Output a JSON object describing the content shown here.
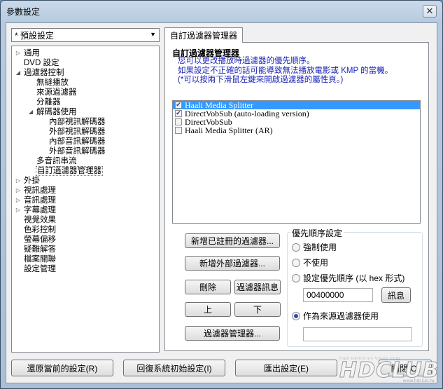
{
  "window": {
    "title": "參數設定",
    "close_glyph": "✕"
  },
  "preset": {
    "value": "* 預設設定"
  },
  "tree": [
    {
      "label": "通用",
      "level": 0,
      "expander": "▷"
    },
    {
      "label": "DVD 設定",
      "level": 0,
      "expander": ""
    },
    {
      "label": "過濾器控制",
      "level": 0,
      "expander": "◢"
    },
    {
      "label": "無縫播放",
      "level": 1,
      "expander": ""
    },
    {
      "label": "來源過濾器",
      "level": 1,
      "expander": ""
    },
    {
      "label": "分離器",
      "level": 1,
      "expander": ""
    },
    {
      "label": "解碼器使用",
      "level": 1,
      "expander": "◢"
    },
    {
      "label": "內部視訊解碼器",
      "level": 2,
      "expander": ""
    },
    {
      "label": "外部視訊解碼器",
      "level": 2,
      "expander": ""
    },
    {
      "label": "內部音訊解碼器",
      "level": 2,
      "expander": ""
    },
    {
      "label": "外部音訊解碼器",
      "level": 2,
      "expander": ""
    },
    {
      "label": "多音訊串流",
      "level": 1,
      "expander": ""
    },
    {
      "label": "自訂過濾器管理器",
      "level": 1,
      "expander": "",
      "selected": true
    },
    {
      "label": "外掛",
      "level": 0,
      "expander": "▷"
    },
    {
      "label": "視訊處理",
      "level": 0,
      "expander": "▷"
    },
    {
      "label": "音訊處理",
      "level": 0,
      "expander": "▷"
    },
    {
      "label": "字幕處理",
      "level": 0,
      "expander": "▷"
    },
    {
      "label": "視覺效果",
      "level": 0,
      "expander": ""
    },
    {
      "label": "色彩控制",
      "level": 0,
      "expander": ""
    },
    {
      "label": "螢幕偏移",
      "level": 0,
      "expander": ""
    },
    {
      "label": "疑難解答",
      "level": 0,
      "expander": ""
    },
    {
      "label": "檔案關聯",
      "level": 0,
      "expander": ""
    },
    {
      "label": "設定管理",
      "level": 0,
      "expander": ""
    }
  ],
  "tab": {
    "label": "自訂過濾器管理器"
  },
  "panel": {
    "title": "自訂過濾器管理器",
    "desc1": "您可以更改播放時過濾器的優先順序。",
    "desc2": "如果設定不正確的話可能導致無法播放電影或 KMP 的當機。",
    "desc3": "(*可以按兩下滑鼠左鍵來開啟過濾器的屬性頁。)"
  },
  "filters": [
    {
      "name": "Haali Media Splitter",
      "checked": true,
      "selected": true
    },
    {
      "name": "DirectVobSub (auto-loading version)",
      "checked": true,
      "selected": false
    },
    {
      "name": "DirectVobSub",
      "checked": false,
      "selected": false
    },
    {
      "name": "Haali Media Splitter (AR)",
      "checked": false,
      "selected": false
    }
  ],
  "buttons": {
    "add_registered": "新增已註冊的過濾器...",
    "add_external": "新增外部過濾器...",
    "delete": "刪除",
    "filter_info": "過濾器訊息",
    "up": "上",
    "down": "下",
    "filter_manager": "過濾器管理器..."
  },
  "priority": {
    "legend": "優先順序設定",
    "force": "強制使用",
    "dont_use": "不使用",
    "set_priority": "設定優先順序 (以 hex 形式)",
    "priority_value": "00400000",
    "info_button": "訊息",
    "as_source": "作為來源過濾器使用",
    "source_value": "",
    "selected_option": "as_source"
  },
  "footer": {
    "restore": "還原當前的設定(R)",
    "reset": "回復系統初始設定(I)",
    "export": "匯出設定(E)",
    "close": "關閉(C)"
  },
  "watermark": {
    "tagline": "High Definition Vision Club",
    "logo": "HDCLUB",
    "url": "www.hdclub.tw"
  }
}
